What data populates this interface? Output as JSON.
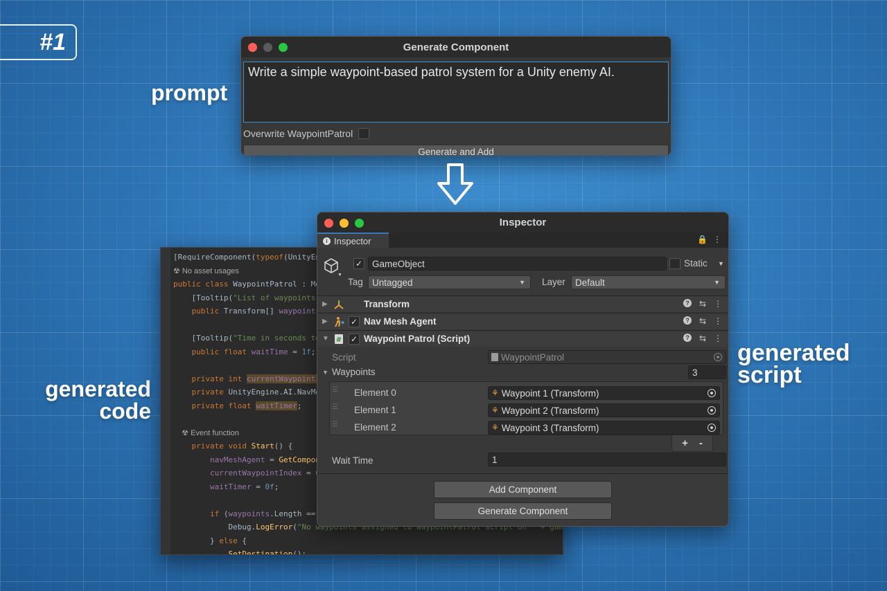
{
  "badge": "#1",
  "captions": {
    "prompt": "prompt",
    "code_line1": "generated",
    "code_line2": "code",
    "script_line1": "generated",
    "script_line2": "script"
  },
  "generate_window": {
    "title": "Generate Component",
    "prompt_text": "Write a simple waypoint-based patrol system for a Unity enemy AI.",
    "overwrite_label": "Overwrite WaypointPatrol",
    "generate_button": "Generate and Add"
  },
  "code": {
    "lines": [
      {
        "parts": [
          [
            "",
            "[RequireComponent("
          ],
          [
            "kw",
            "typeof"
          ],
          [
            "",
            "(UnityEngi"
          ]
        ]
      },
      {
        "parts": [
          [
            "hint",
            "☢ No asset usages"
          ]
        ]
      },
      {
        "parts": [
          [
            "kw",
            "public class "
          ],
          [
            "",
            "WaypointPatrol : Mono"
          ]
        ]
      },
      {
        "parts": [
          [
            "",
            "    [Tooltip("
          ],
          [
            "str",
            "\"List of waypoints fo"
          ]
        ]
      },
      {
        "parts": [
          [
            "kw",
            "    public "
          ],
          [
            "",
            "Transform[] "
          ],
          [
            "fld",
            "waypoints"
          ],
          [
            "",
            ";"
          ]
        ]
      },
      {
        "parts": [
          [
            "",
            ""
          ]
        ]
      },
      {
        "parts": [
          [
            "",
            "    [Tooltip("
          ],
          [
            "str",
            "\"Time in seconds to w"
          ]
        ]
      },
      {
        "parts": [
          [
            "kw",
            "    public float "
          ],
          [
            "fld",
            "waitTime"
          ],
          [
            "",
            " = "
          ],
          [
            "num",
            "1f"
          ],
          [
            "",
            ";"
          ]
        ]
      },
      {
        "parts": [
          [
            "",
            ""
          ]
        ]
      },
      {
        "parts": [
          [
            "kw",
            "    private int "
          ],
          [
            "fld hl",
            "currentWaypointInd"
          ]
        ]
      },
      {
        "parts": [
          [
            "kw",
            "    private "
          ],
          [
            "",
            "UnityEngine.AI.NavMesh"
          ]
        ]
      },
      {
        "parts": [
          [
            "kw",
            "    private float "
          ],
          [
            "fld hl",
            "waitTimer"
          ],
          [
            "",
            ";"
          ]
        ]
      },
      {
        "parts": [
          [
            "",
            ""
          ]
        ]
      },
      {
        "parts": [
          [
            "hint",
            "    ☢ Event function"
          ]
        ]
      },
      {
        "parts": [
          [
            "kw",
            "    private void "
          ],
          [
            "fn",
            "Start"
          ],
          [
            "",
            "() {"
          ]
        ]
      },
      {
        "parts": [
          [
            "fld",
            "        navMeshAgent"
          ],
          [
            "",
            " = "
          ],
          [
            "fn",
            "GetComponen"
          ]
        ]
      },
      {
        "parts": [
          [
            "fld",
            "        currentWaypointIndex"
          ],
          [
            "",
            " = "
          ],
          [
            "num",
            "0"
          ],
          [
            "",
            ";"
          ]
        ]
      },
      {
        "parts": [
          [
            "fld",
            "        waitTimer"
          ],
          [
            "",
            " = "
          ],
          [
            "num",
            "0f"
          ],
          [
            "",
            ";"
          ]
        ]
      },
      {
        "parts": [
          [
            "",
            ""
          ]
        ]
      },
      {
        "parts": [
          [
            "kw",
            "        if "
          ],
          [
            "",
            "("
          ],
          [
            "fld",
            "waypoints"
          ],
          [
            "",
            ".Length == "
          ],
          [
            "num",
            "0"
          ],
          [
            "",
            ")"
          ]
        ]
      },
      {
        "parts": [
          [
            "",
            "            Debug."
          ],
          [
            "fn",
            "LogError"
          ],
          [
            "",
            "("
          ],
          [
            "str",
            "\"No waypoints assigned to WaypointPatrol script on \" + gameObject.na"
          ]
        ]
      },
      {
        "parts": [
          [
            "",
            "        } "
          ],
          [
            "kw",
            "else "
          ],
          [
            "",
            "{"
          ]
        ]
      },
      {
        "parts": [
          [
            "fn",
            "            SetDestination"
          ],
          [
            "",
            "();"
          ]
        ]
      }
    ]
  },
  "inspector": {
    "title": "Inspector",
    "tab_label": "Inspector",
    "gameobject_name": "GameObject",
    "static_label": "Static",
    "tag_label": "Tag",
    "tag_value": "Untagged",
    "layer_label": "Layer",
    "layer_value": "Default",
    "components": {
      "transform": "Transform",
      "navmesh": "Nav Mesh Agent",
      "patrol": "Waypoint Patrol (Script)"
    },
    "script_label": "Script",
    "script_value": "WaypointPatrol",
    "waypoints_label": "Waypoints",
    "waypoints_count": "3",
    "elements": [
      {
        "label": "Element 0",
        "value": "Waypoint 1 (Transform)"
      },
      {
        "label": "Element 1",
        "value": "Waypoint 2 (Transform)"
      },
      {
        "label": "Element 2",
        "value": "Waypoint 3 (Transform)"
      }
    ],
    "plus": "+",
    "minus": "-",
    "wait_time_label": "Wait Time",
    "wait_time_value": "1",
    "add_component": "Add Component",
    "generate_component": "Generate Component"
  },
  "colors": {
    "close": "#ff5f57",
    "minimize_inactive": "#5a5a5a",
    "minimize": "#febc2e",
    "zoom": "#28c840",
    "accent": "#3a79bb"
  }
}
